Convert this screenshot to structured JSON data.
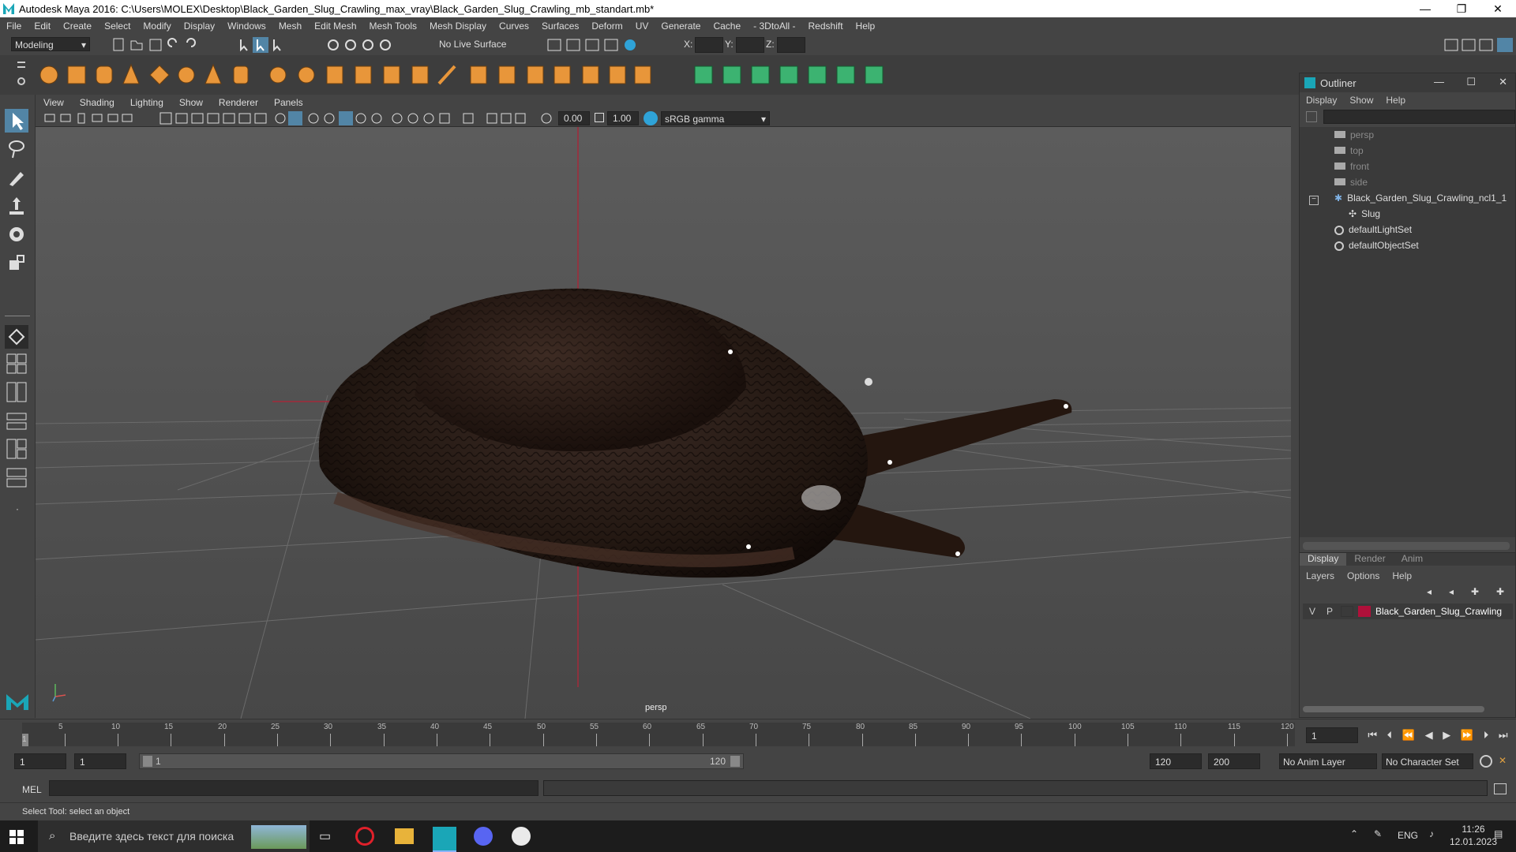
{
  "window": {
    "title": "Autodesk Maya 2016: C:\\Users\\MOLEX\\Desktop\\Black_Garden_Slug_Crawling_max_vray\\Black_Garden_Slug_Crawling_mb_standart.mb*",
    "minimize": "—",
    "restore": "❐",
    "close": "✕"
  },
  "menubar": [
    "File",
    "Edit",
    "Create",
    "Select",
    "Modify",
    "Display",
    "Windows",
    "Mesh",
    "Edit Mesh",
    "Mesh Tools",
    "Mesh Display",
    "Curves",
    "Surfaces",
    "Deform",
    "UV",
    "Generate",
    "Cache",
    "- 3DtoAll -",
    "Redshift",
    "Help"
  ],
  "statusline": {
    "mode": "Modeling",
    "live_surface": "No Live Surface",
    "x_label": "X:",
    "y_label": "Y:",
    "z_label": "Z:"
  },
  "viewport": {
    "menu": [
      "View",
      "Shading",
      "Lighting",
      "Show",
      "Renderer",
      "Panels"
    ],
    "field1": "0.00",
    "field2": "1.00",
    "colorspace": "sRGB gamma",
    "camera_label": "persp"
  },
  "outliner": {
    "title": "Outliner",
    "menu": [
      "Display",
      "Show",
      "Help"
    ],
    "items": [
      {
        "label": "persp",
        "dim": true
      },
      {
        "label": "top",
        "dim": true
      },
      {
        "label": "front",
        "dim": true
      },
      {
        "label": "side",
        "dim": true
      },
      {
        "label": "Black_Garden_Slug_Crawling_ncl1_1",
        "dim": false
      },
      {
        "label": "Slug",
        "dim": false
      },
      {
        "label": "defaultLightSet",
        "dim": false
      },
      {
        "label": "defaultObjectSet",
        "dim": false
      }
    ]
  },
  "layer_editor": {
    "tabs": [
      "Display",
      "Render",
      "Anim"
    ],
    "menu": [
      "Layers",
      "Options",
      "Help"
    ],
    "layer": {
      "v": "V",
      "p": "P",
      "name": "Black_Garden_Slug_Crawling",
      "color": "#b0103a"
    }
  },
  "timeslider": {
    "ticks": [
      "5",
      "10",
      "15",
      "20",
      "25",
      "30",
      "35",
      "40",
      "45",
      "50",
      "55",
      "60",
      "65",
      "70",
      "75",
      "80",
      "85",
      "90",
      "95",
      "100",
      "105",
      "110",
      "115",
      "120"
    ],
    "start_marker": "1",
    "current_frame": "1"
  },
  "range": {
    "start": "1",
    "playback_start": "1",
    "range_left": "1",
    "range_right": "120",
    "playback_end": "120",
    "end": "200",
    "anim_layer": "No Anim Layer",
    "char_set": "No Character Set"
  },
  "cmdline": {
    "label": "MEL"
  },
  "helpline": {
    "text": "Select Tool: select an object"
  },
  "taskbar": {
    "search_placeholder": "Введите здесь текст для поиска",
    "lang": "ENG",
    "time": "11:26",
    "date": "12.01.2023"
  },
  "colors": {
    "accent": "#5285a6",
    "bg": "#444444",
    "viewport_top": "#5c5c5c"
  }
}
